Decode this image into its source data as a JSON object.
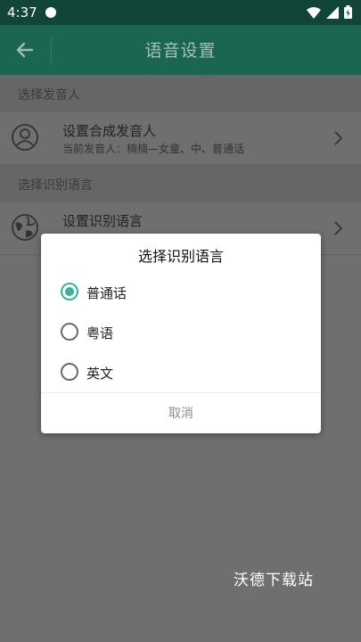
{
  "status_bar": {
    "time": "4:37"
  },
  "app_bar": {
    "title": "语音设置"
  },
  "sections": [
    {
      "header": "选择发音人",
      "row_title": "设置合成发音人",
      "row_subtitle": "当前发音人：楠楠—女童、中、普通话"
    },
    {
      "header": "选择识别语言",
      "row_title": "设置识别语言"
    }
  ],
  "dialog": {
    "title": "选择识别语言",
    "options": [
      {
        "label": "普通话",
        "selected": true
      },
      {
        "label": "粤语",
        "selected": false
      },
      {
        "label": "英文",
        "selected": false
      }
    ],
    "cancel_label": "取消"
  },
  "watermark": "沃德下载站",
  "colors": {
    "accent": "#38b39a",
    "appbar": "#1a6652",
    "statusbar": "#11453a"
  }
}
